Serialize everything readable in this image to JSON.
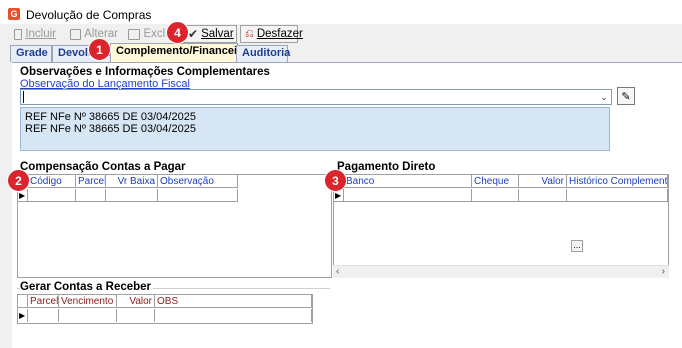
{
  "window": {
    "title": "Devolução de Compras",
    "app_icon_letter": "G"
  },
  "toolbar": {
    "incluir": "Incluir",
    "alterar": "Alterar",
    "excluir": "Excluir",
    "salvar": "Salvar",
    "desfazer": "Desfazer"
  },
  "tabs": [
    {
      "label": "Grade"
    },
    {
      "label": "Devolução"
    },
    {
      "label": "Complemento/Financeiro"
    },
    {
      "label": "Auditoria"
    }
  ],
  "observacoes": {
    "section_title": "Observações e Informações Complementares",
    "field_label": "Observação do Lançamento Fiscal",
    "combo_value": "",
    "notes": [
      "REF NFe Nº 38665 DE 03/04/2025",
      "REF NFe Nº 38665 DE 03/04/2025"
    ]
  },
  "compensacao": {
    "section_title": "Compensação Contas a Pagar",
    "columns": [
      "Código",
      "Parcela",
      "Vr Baixa",
      "Observação"
    ]
  },
  "pagamento": {
    "section_title": "Pagamento Direto",
    "columns": [
      "Banco",
      "Cheque",
      "Valor",
      "Histórico Complementar"
    ],
    "ellipsis_label": "..."
  },
  "gerar": {
    "section_title": "Gerar Contas a Receber",
    "columns": [
      "Parcela",
      "Vencimento",
      "Valor",
      "OBS"
    ]
  },
  "badges": {
    "b1": "1",
    "b2": "2",
    "b3": "3",
    "b4": "4"
  },
  "colors": {
    "badge": "#d9252b",
    "tab_active": "#fff9d9",
    "notes_bg": "#d6e6f5",
    "link": "#2140c8"
  }
}
